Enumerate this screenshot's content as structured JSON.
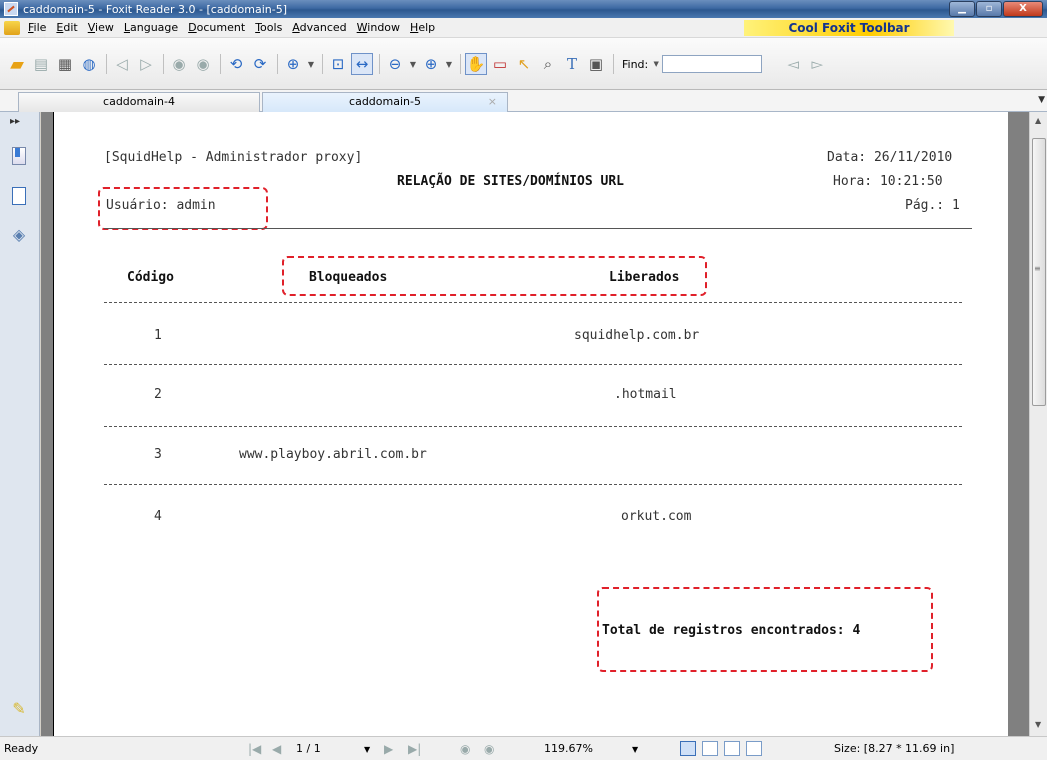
{
  "window": {
    "title": "caddomain-5 - Foxit Reader 3.0 - [caddomain-5]",
    "buttons": {
      "minimize": "▁",
      "maximize": "▫",
      "close": "X"
    }
  },
  "menu": {
    "items": [
      "File",
      "Edit",
      "View",
      "Language",
      "Document",
      "Tools",
      "Advanced",
      "Window",
      "Help"
    ],
    "cool_toolbar": "Cool Foxit Toolbar"
  },
  "toolbar": {
    "find_label": "Find:",
    "find_value": ""
  },
  "tabs": [
    {
      "label": "caddomain-4"
    },
    {
      "label": "caddomain-5",
      "close": "×"
    }
  ],
  "document": {
    "header_left": "[SquidHelp - Administrador proxy]",
    "date": "Data: 26/11/2010",
    "title": "RELAÇÃO DE SITES/DOMÍNIOS URL",
    "time": "Hora: 10:21:50",
    "user": "Usuário: admin",
    "page": "Pág.: 1",
    "columns": {
      "code": "Código",
      "blocked": "Bloqueados",
      "allowed": "Liberados"
    },
    "rows": [
      {
        "code": "1",
        "blocked": "",
        "allowed": "squidhelp.com.br"
      },
      {
        "code": "2",
        "blocked": "",
        "allowed": ".hotmail"
      },
      {
        "code": "3",
        "blocked": "www.playboy.abril.com.br",
        "allowed": ""
      },
      {
        "code": "4",
        "blocked": "",
        "allowed": "orkut.com"
      }
    ],
    "total": "Total de registros encontrados: 4"
  },
  "status": {
    "ready": "Ready",
    "page_indicator": "1 / 1",
    "zoom": "119.67%",
    "size": "Size: [8.27 * 11.69 in]"
  }
}
